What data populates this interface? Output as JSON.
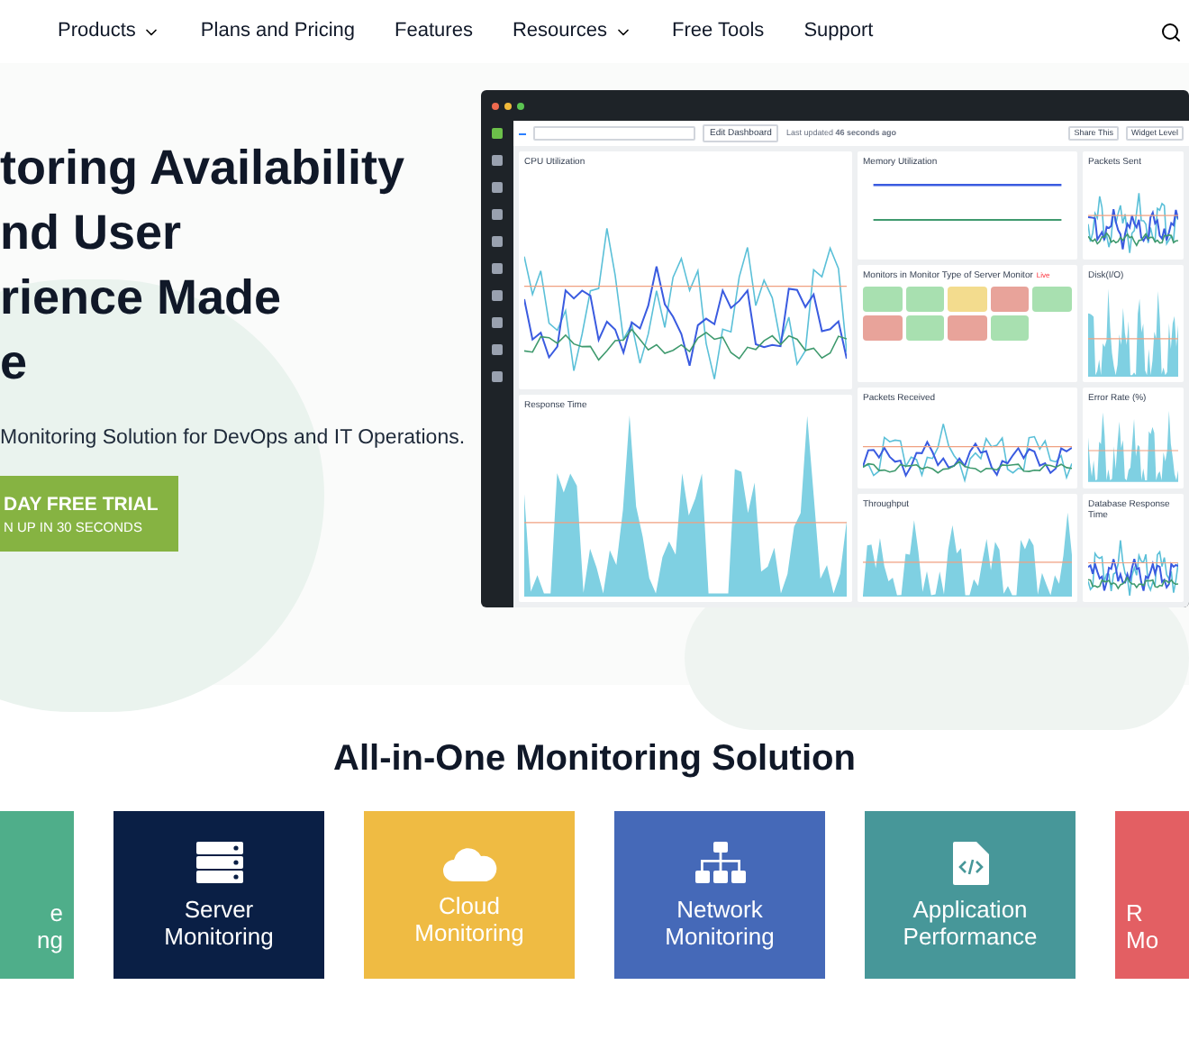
{
  "nav": {
    "items": [
      {
        "label": "Products",
        "has_dropdown": true
      },
      {
        "label": "Plans and Pricing",
        "has_dropdown": false
      },
      {
        "label": "Features",
        "has_dropdown": false
      },
      {
        "label": "Resources",
        "has_dropdown": true
      },
      {
        "label": "Free Tools",
        "has_dropdown": false
      },
      {
        "label": "Support",
        "has_dropdown": false
      }
    ]
  },
  "hero": {
    "headline_lines": [
      "toring Availability",
      "nd User",
      "rience Made",
      "e"
    ],
    "subtitle": "Monitoring Solution for DevOps and IT Operations.",
    "cta": {
      "title": "DAY FREE TRIAL",
      "subtitle": "N UP IN 30 SECONDS"
    }
  },
  "dashboard": {
    "toolbar": {
      "edit_button": "Edit Dashboard",
      "last_updated": "Last updated **46 seconds ago**",
      "share_button": "Share This",
      "widget_button": "Widget Level"
    },
    "columns": [
      {
        "panels": [
          {
            "title": "CPU Utilization",
            "kind": "line"
          },
          {
            "title": "Response Time",
            "kind": "area"
          }
        ]
      },
      {
        "panels": [
          {
            "title": "Memory Utilization",
            "kind": "flat"
          },
          {
            "title": "Monitors in Monitor Type of Server Monitor",
            "badge": "Live",
            "kind": "heatmap",
            "cells": [
              {
                "color": "#a8e0b0"
              },
              {
                "color": "#a8e0b0"
              },
              {
                "color": "#f3dc8e"
              },
              {
                "color": "#e8a39a"
              },
              {
                "color": "#a8e0b0"
              },
              {
                "color": "#e8a39a"
              },
              {
                "color": "#a8e0b0"
              },
              {
                "color": "#e8a39a"
              },
              {
                "color": "#a8e0b0"
              }
            ]
          },
          {
            "title": "Packets Received",
            "kind": "line"
          },
          {
            "title": "Throughput",
            "kind": "area"
          }
        ]
      },
      {
        "panels": [
          {
            "title": "Packets Sent",
            "kind": "line"
          },
          {
            "title": "Disk(I/O)",
            "kind": "area"
          },
          {
            "title": "Error Rate (%)",
            "kind": "area"
          },
          {
            "title": "Database Response Time",
            "kind": "line"
          }
        ]
      }
    ]
  },
  "solutions": {
    "title": "All-in-One Monitoring Solution",
    "tiles": [
      {
        "lines": [
          "e",
          "ng"
        ],
        "color": "#4fae8a",
        "kind": "plain"
      },
      {
        "lines": [
          "Server",
          "Monitoring"
        ],
        "color": "#0a1f45",
        "kind": "server"
      },
      {
        "lines": [
          "Cloud",
          "Monitoring"
        ],
        "color": "#efbb43",
        "kind": "cloud"
      },
      {
        "lines": [
          "Network",
          "Monitoring"
        ],
        "color": "#4569b8",
        "kind": "network"
      },
      {
        "lines": [
          "Application",
          "Performance"
        ],
        "color": "#479799",
        "kind": "code"
      },
      {
        "lines": [
          "R",
          "Mo"
        ],
        "color": "#e35f63",
        "kind": "plain"
      }
    ]
  }
}
